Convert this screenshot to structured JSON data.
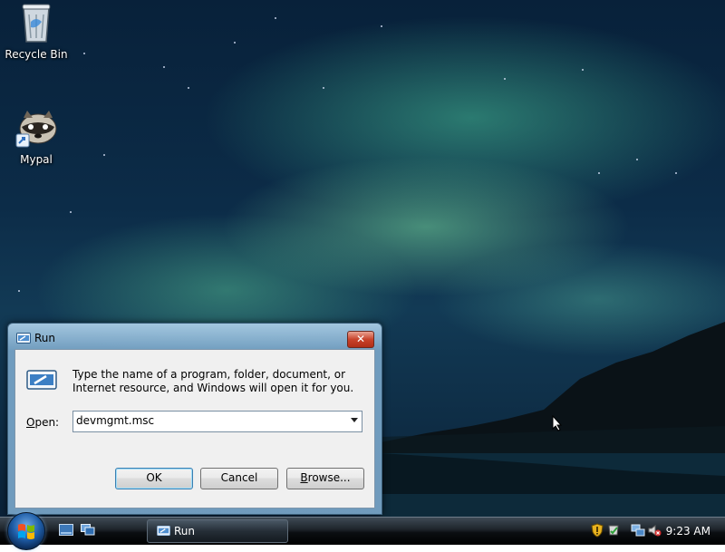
{
  "desktop": {
    "icons": [
      {
        "label": "Recycle Bin",
        "icon": "recycle-bin-icon"
      },
      {
        "label": "Mypal",
        "icon": "mypal-raccoon-icon"
      }
    ]
  },
  "run_dialog": {
    "title": "Run",
    "close_label": "✕",
    "description": "Type the name of a program, folder, document, or Internet resource, and Windows will open it for you.",
    "open_label_accesskey": "O",
    "open_label_rest": "pen:",
    "open_value": "devmgmt.msc",
    "buttons": {
      "ok": "OK",
      "cancel": "Cancel",
      "browse_accesskey": "B",
      "browse_rest": "rowse..."
    }
  },
  "taskbar": {
    "start_icon": "windows-start-orb",
    "quick_launch": [
      "show-desktop-icon",
      "switch-windows-icon"
    ],
    "tasks": [
      {
        "label": "Run",
        "icon": "run-icon"
      }
    ],
    "tray_icons": [
      "shield-warning-icon",
      "network-icon",
      "volume-muted-icon"
    ],
    "clock": "9:23 AM"
  },
  "colors": {
    "taskbar": "#1d2329",
    "dialog_border": "#3b5f7a",
    "close_button": "#c8432b",
    "aurora": "#5fd3a0"
  }
}
